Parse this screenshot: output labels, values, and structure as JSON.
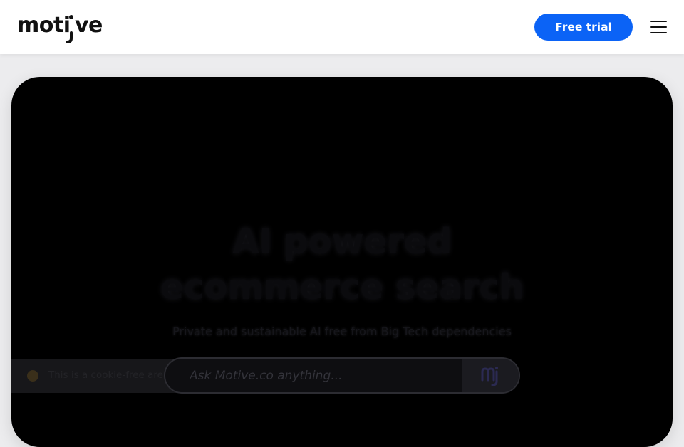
{
  "header": {
    "logo_text": "motive",
    "cta_label": "Free trial",
    "menu_icon": "hamburger-menu-icon",
    "accent_color": "#0b63f6"
  },
  "hero": {
    "title_line1": "AI powered",
    "title_line2": "ecommerce search",
    "subtitle": "Private and sustainable AI free from Big Tech dependencies",
    "background_color": "#000000"
  },
  "cookie_notice": {
    "text": "This is a cookie-free area.",
    "close_icon": "close-icon"
  },
  "search": {
    "placeholder": "Ask Motive.co anything...",
    "button_icon": "motive-logo-icon"
  }
}
